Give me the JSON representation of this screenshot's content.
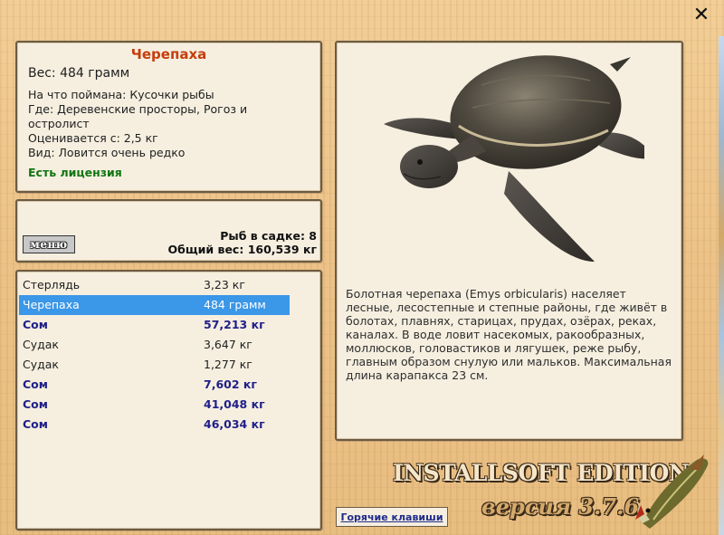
{
  "window": {
    "close_glyph": "✕"
  },
  "fish_info": {
    "name": "Черепаха",
    "weight_line": "Вес: 484 грамм",
    "caught_on": "На что поймана: Кусочки рыбы",
    "where": "Где: Деревенские просторы, Рогоз и остролист",
    "price": "Оценивается с: 2,5 кг",
    "kind": "Вид: Ловится очень редко",
    "license": "Есть лицензия"
  },
  "stats": {
    "menu_label": "меню",
    "fish_count": "Рыб в садке: 8",
    "total_weight": "Общий вес: 160,539 кг"
  },
  "catch_list": [
    {
      "name": "Стерлядь",
      "weight": "3,23 кг",
      "style": "normal"
    },
    {
      "name": "Черепаха",
      "weight": "484 грамм",
      "style": "selected"
    },
    {
      "name": "Сом",
      "weight": "57,213 кг",
      "style": "trophy"
    },
    {
      "name": "Судак",
      "weight": "3,647 кг",
      "style": "normal"
    },
    {
      "name": "Судак",
      "weight": "1,277 кг",
      "style": "normal"
    },
    {
      "name": "Сом",
      "weight": "7,602 кг",
      "style": "trophy"
    },
    {
      "name": "Сом",
      "weight": "41,048 кг",
      "style": "trophy"
    },
    {
      "name": "Сом",
      "weight": "46,034 кг",
      "style": "trophy"
    }
  ],
  "description": "Болотная черепаха (Emys orbicularis) населяет лесные, лесостепные и степные районы, где живёт в болотах, плавнях, старицах, прудах, озёрах, реках, каналах. В воде ловит насекомых, ракообразных, моллюсков, головастиков и лягушек, реже рыбу, главным образом снулую или мальков. Максимальная длина карапакса 23 см.",
  "hotkeys_label": "Горячие клавиши",
  "branding": {
    "edition": "INSTALLSOFT EDITION",
    "version": "версия 3.7.6"
  },
  "colors": {
    "title": "#c43e0c",
    "license": "#117511",
    "selected_row": "#3b97e7",
    "trophy_text": "#1f1f8a",
    "link": "#1e2b8c"
  }
}
